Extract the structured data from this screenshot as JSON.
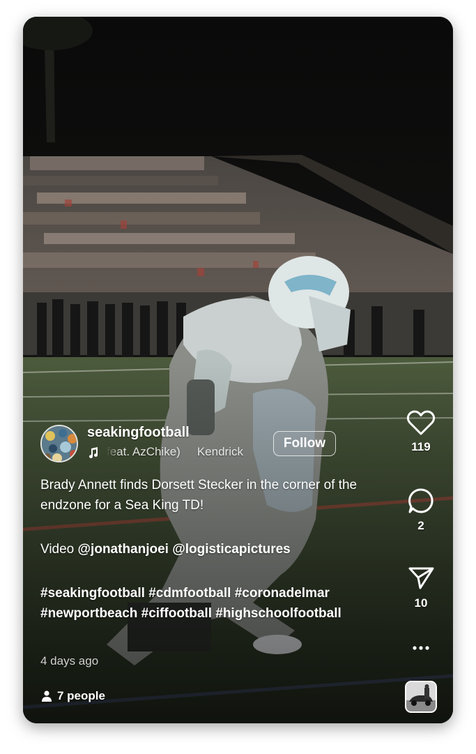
{
  "post": {
    "username": "seakingfootball",
    "music_ticker": "feat. AzChike)",
    "music_ticker_2": "Kendrick",
    "follow_label": "Follow",
    "caption_line_1": "Brady Annett finds Dorsett Stecker in the corner of the endzone for a Sea King TD!",
    "video_prefix": "Video ",
    "mention_1": "@jonathanjoei",
    "mention_2": "@logisticapictures",
    "hashtags": "#seakingfootball #cdmfootball #coronadelmar #newportbeach #ciffootball #highschoolfootball",
    "timestamp": "4 days ago",
    "people_label": "7 people"
  },
  "actions": {
    "likes": "119",
    "comments": "2",
    "shares": "10"
  },
  "icons": {
    "like": "heart-icon",
    "comment": "comment-bubble-icon",
    "share": "paper-plane-icon",
    "more": "more-dots-icon",
    "music": "music-note-icon",
    "people": "person-icon"
  }
}
